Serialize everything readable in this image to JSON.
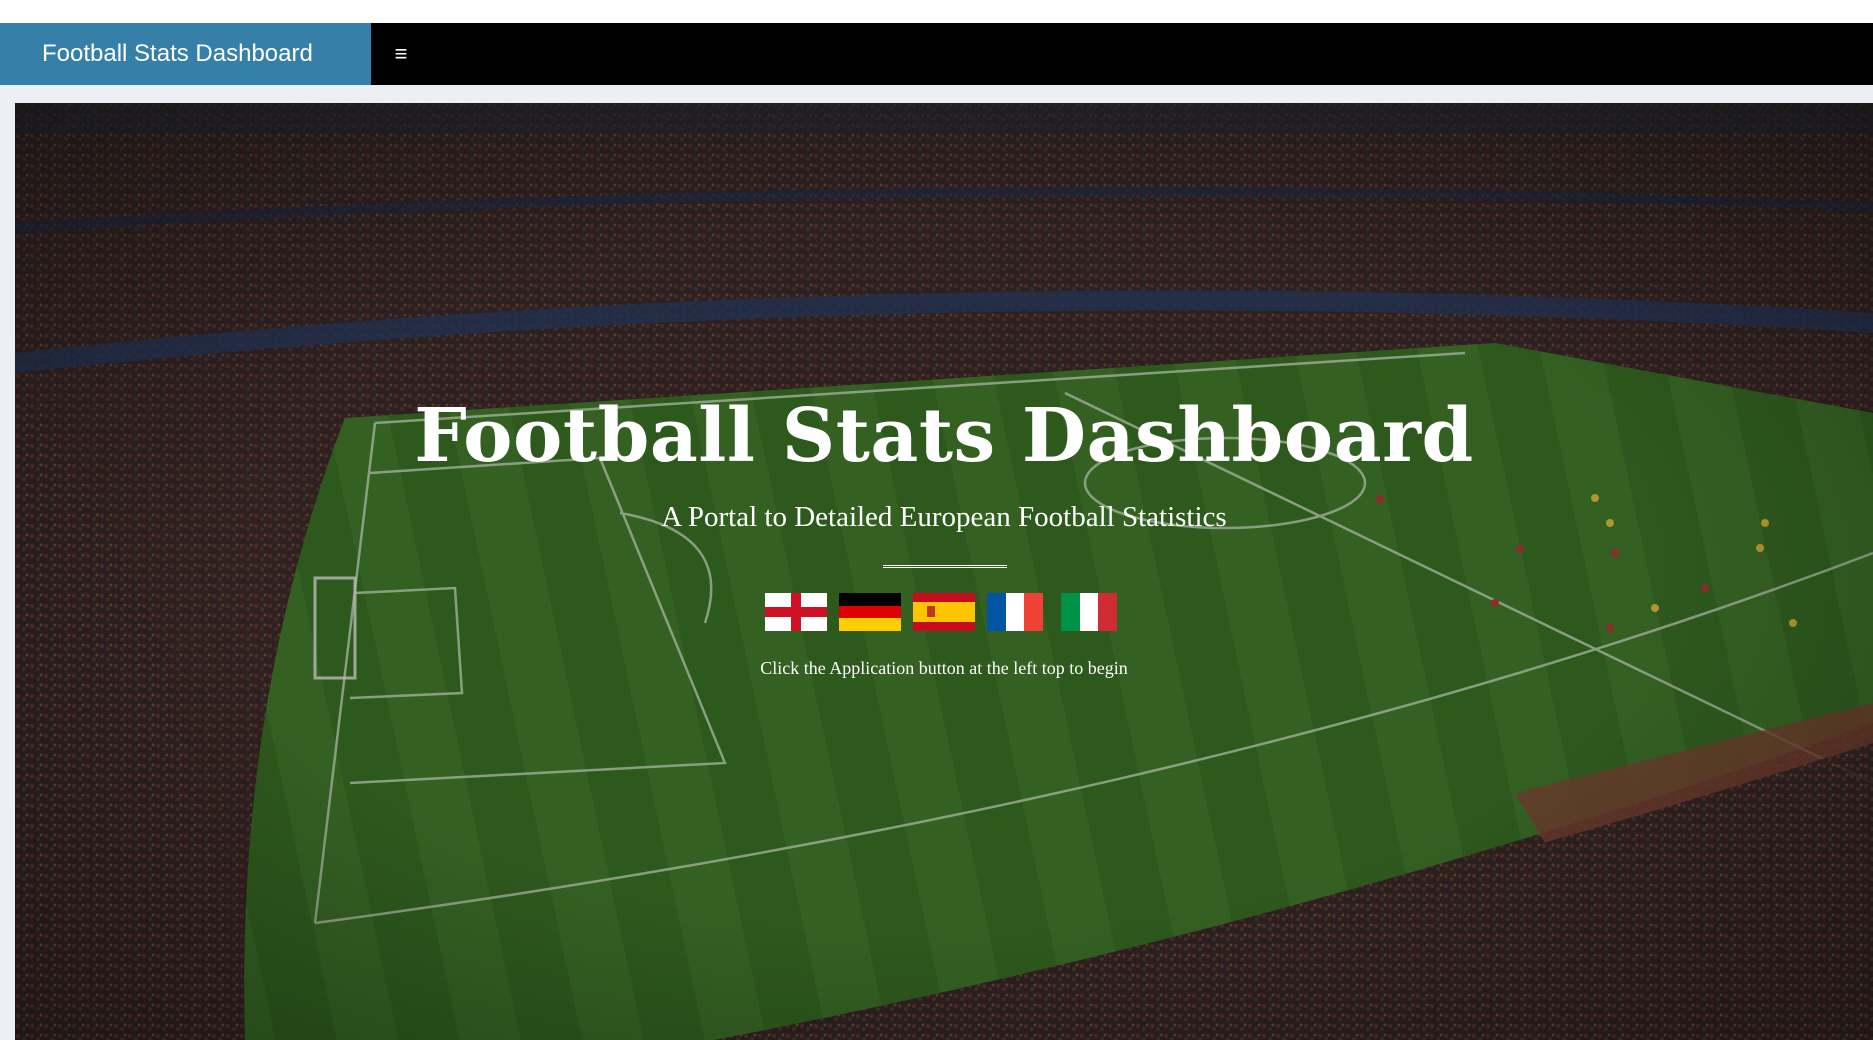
{
  "header": {
    "brand": "Football Stats Dashboard",
    "toggle_icon": "≡"
  },
  "hero": {
    "title": "Football Stats Dashboard",
    "subtitle": "A Portal to Detailed European Football Statistics",
    "hint": "Click the Application button at the left top to begin",
    "flags": [
      {
        "name": "england-flag-icon"
      },
      {
        "name": "germany-flag-icon"
      },
      {
        "name": "spain-flag-icon"
      },
      {
        "name": "france-flag-icon"
      },
      {
        "name": "italy-flag-icon"
      }
    ]
  },
  "colors": {
    "brand_bg": "#367fa9",
    "navbar_bg": "#000000",
    "content_bg": "#ecf0f5",
    "pitch": "#3f7a2a",
    "stands": "#3a2a2a"
  }
}
